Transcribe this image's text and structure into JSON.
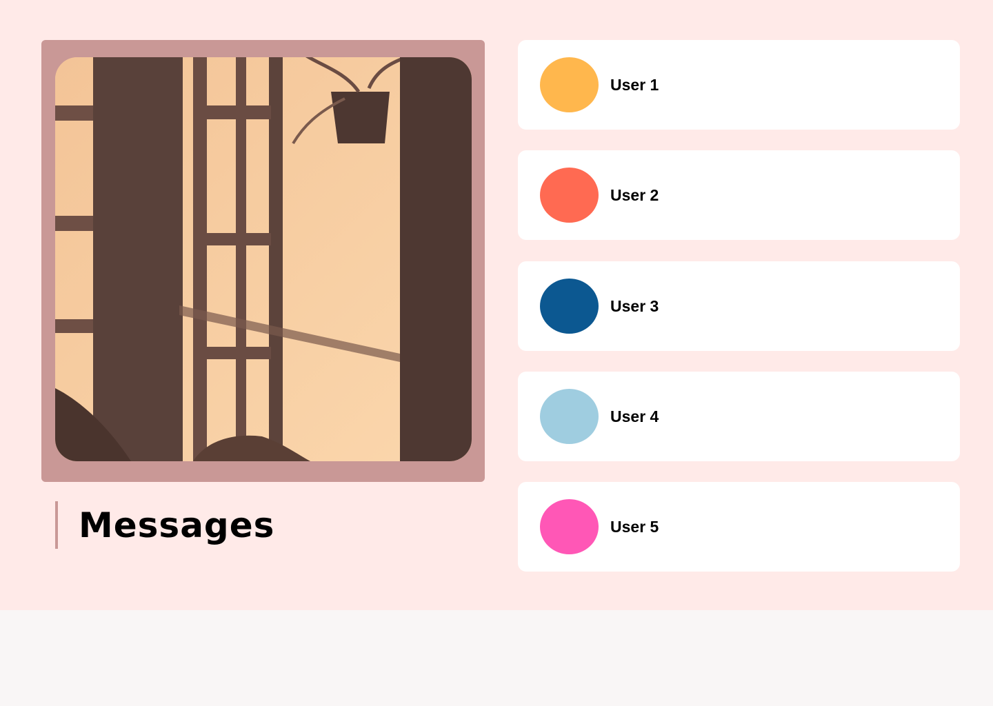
{
  "page": {
    "title": "Messages"
  },
  "colors": {
    "panel_background": "#ffeae8",
    "frame": "#c99896",
    "page_background": "#f9f6f6"
  },
  "users": [
    {
      "name": "User 1",
      "avatar_color": "#ffb74d"
    },
    {
      "name": "User 2",
      "avatar_color": "#ff6a52"
    },
    {
      "name": "User 3",
      "avatar_color": "#0c5891"
    },
    {
      "name": "User 4",
      "avatar_color": "#9fcde0"
    },
    {
      "name": "User 5",
      "avatar_color": "#ff57b6"
    }
  ]
}
